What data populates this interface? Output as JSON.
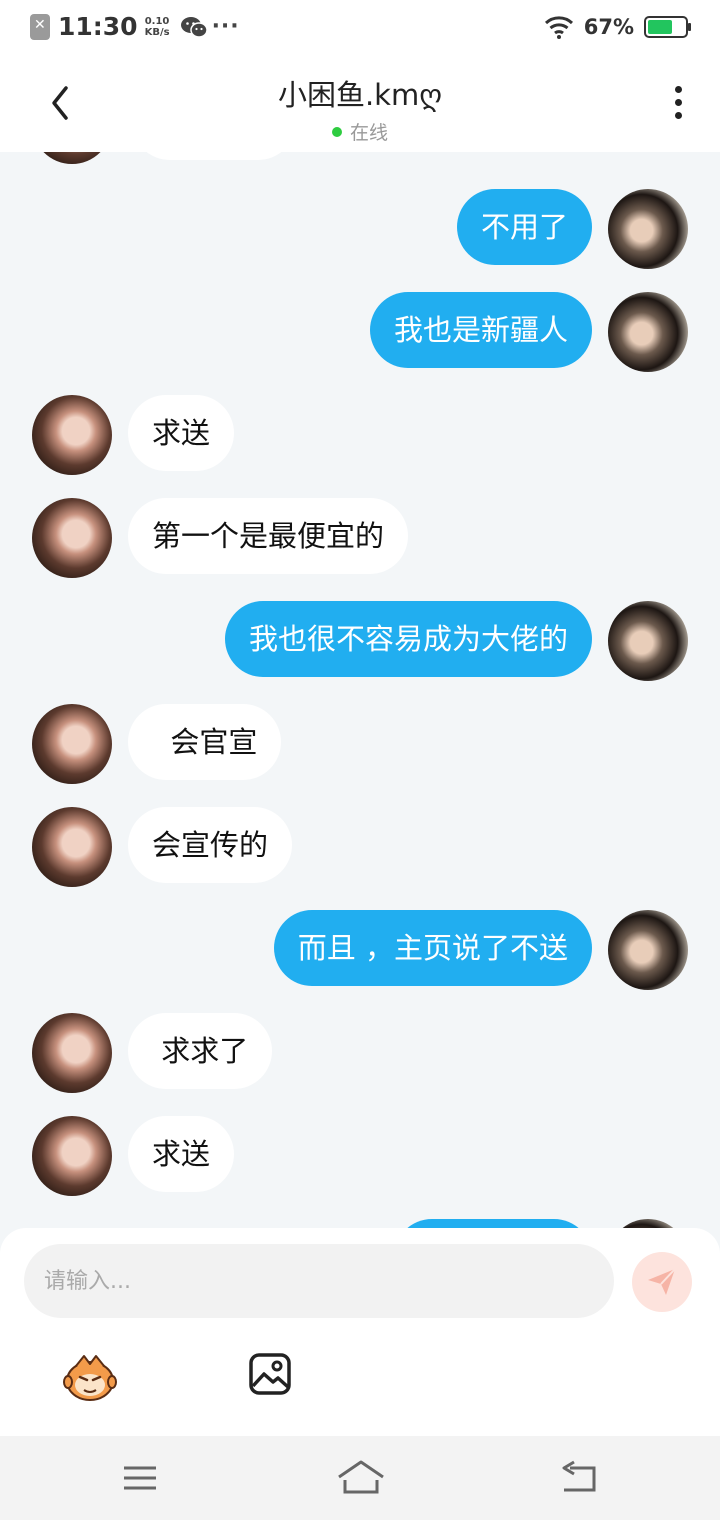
{
  "status_bar": {
    "time": "11:30",
    "net_speed_value": "0.10",
    "net_speed_unit": "KB/s",
    "dots": "···",
    "battery_percent": "67%",
    "battery_level": 0.67
  },
  "header": {
    "title": "小困鱼.kmღ",
    "status": "在线"
  },
  "messages": [
    {
      "from": "self",
      "text": "不用了"
    },
    {
      "from": "self",
      "text": "我也是新疆人"
    },
    {
      "from": "other",
      "text": "求送"
    },
    {
      "from": "other",
      "text": "第一个是最便宜的"
    },
    {
      "from": "self",
      "text": "我也很不容易成为大佬的"
    },
    {
      "from": "other",
      "text": "  会官宣"
    },
    {
      "from": "other",
      "text": "会宣传的"
    },
    {
      "from": "self",
      "text": "而且 ，主页说了不送"
    },
    {
      "from": "other",
      "text": " 求求了"
    },
    {
      "from": "other",
      "text": "求送"
    }
  ],
  "composer": {
    "placeholder": "请输入..."
  },
  "colors": {
    "self_bubble": "#21aef0",
    "other_bubble": "#ffffff",
    "online_dot": "#2ecc40",
    "send_button": "#fde3dd",
    "battery": "#22c55e"
  },
  "icons": [
    "back-arrow-icon",
    "more-vertical-icon",
    "send-icon",
    "emoji-mascot-icon",
    "image-icon",
    "menu-icon",
    "home-icon",
    "back-icon",
    "wifi-icon",
    "battery-icon",
    "wechat-icon"
  ]
}
